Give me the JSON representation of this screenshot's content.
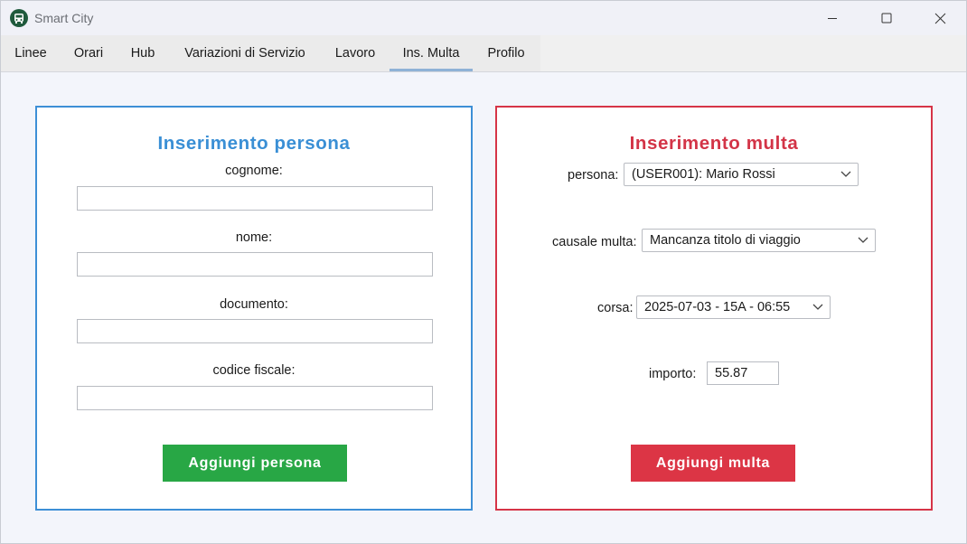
{
  "window": {
    "title": "Smart City"
  },
  "tabs": [
    {
      "label": "Linee"
    },
    {
      "label": "Orari"
    },
    {
      "label": "Hub"
    },
    {
      "label": "Variazioni di Servizio"
    },
    {
      "label": "Lavoro"
    },
    {
      "label": "Ins. Multa",
      "active": true
    },
    {
      "label": "Profilo"
    }
  ],
  "persona_form": {
    "title": "Inserimento persona",
    "accent_color": "#3a8fd5",
    "fields": [
      {
        "label": "cognome:",
        "value": ""
      },
      {
        "label": "nome:",
        "value": ""
      },
      {
        "label": "documento:",
        "value": ""
      },
      {
        "label": "codice fiscale:",
        "value": ""
      }
    ],
    "submit_label": "Aggiungi persona",
    "submit_color": "#28a745"
  },
  "multa_form": {
    "title": "Inserimento multa",
    "accent_color": "#d33447",
    "persona": {
      "label": "persona:",
      "selected": "(USER001): Mario Rossi"
    },
    "causale": {
      "label": "causale multa:",
      "selected": "Mancanza titolo di viaggio"
    },
    "corsa": {
      "label": "corsa:",
      "selected": "2025-07-03 - 15A - 06:55"
    },
    "importo": {
      "label": "importo:",
      "value": "55.87"
    },
    "submit_label": "Aggiungi multa",
    "submit_color": "#dc3545"
  }
}
